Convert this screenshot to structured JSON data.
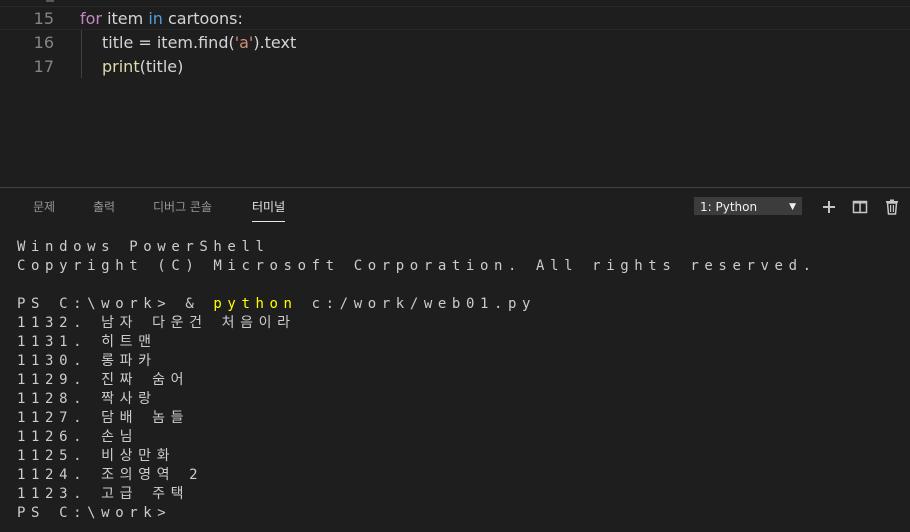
{
  "editor": {
    "lines": [
      {
        "number": "15",
        "tokens": [
          "for",
          " item ",
          "in",
          " cartoons:"
        ]
      },
      {
        "number": "16",
        "tokens": [
          "title = item.find(",
          "'a'",
          ").text"
        ]
      },
      {
        "number": "17",
        "tokens": [
          "print",
          "(title)"
        ]
      }
    ]
  },
  "panel": {
    "tabs": [
      {
        "label": "문제",
        "active": false
      },
      {
        "label": "출력",
        "active": false
      },
      {
        "label": "디버그 콘솔",
        "active": false
      },
      {
        "label": "터미널",
        "active": true
      }
    ],
    "terminal_selector": "1: Python",
    "actions": [
      "plus-icon",
      "split-icon",
      "trash-icon"
    ]
  },
  "terminal": {
    "header_lines": [
      "Windows PowerShell",
      "Copyright (C) Microsoft Corporation. All rights reserved."
    ],
    "command": {
      "prompt": "PS C:\\work> & ",
      "program": "python",
      "args": " c:/work/web01.py"
    },
    "output_lines": [
      "1132. 남자 다운건 처음이라",
      "1131. 히트맨",
      "1130. 롱파카",
      "1129. 진짜 숨어",
      "1128. 짝사랑",
      "1127. 담배 놈들",
      "1126. 손님",
      "1125. 비상만화",
      "1124. 조의영역 2",
      "1123. 고급 주택"
    ],
    "final_prompt": "PS C:\\work>"
  },
  "colors": {
    "background": "#1e1e1e",
    "keyword_flow": "#c586c0",
    "keyword": "#569cd6",
    "string": "#ce9178",
    "function": "#dcdcaa",
    "terminal_highlight": "#ffff00"
  }
}
